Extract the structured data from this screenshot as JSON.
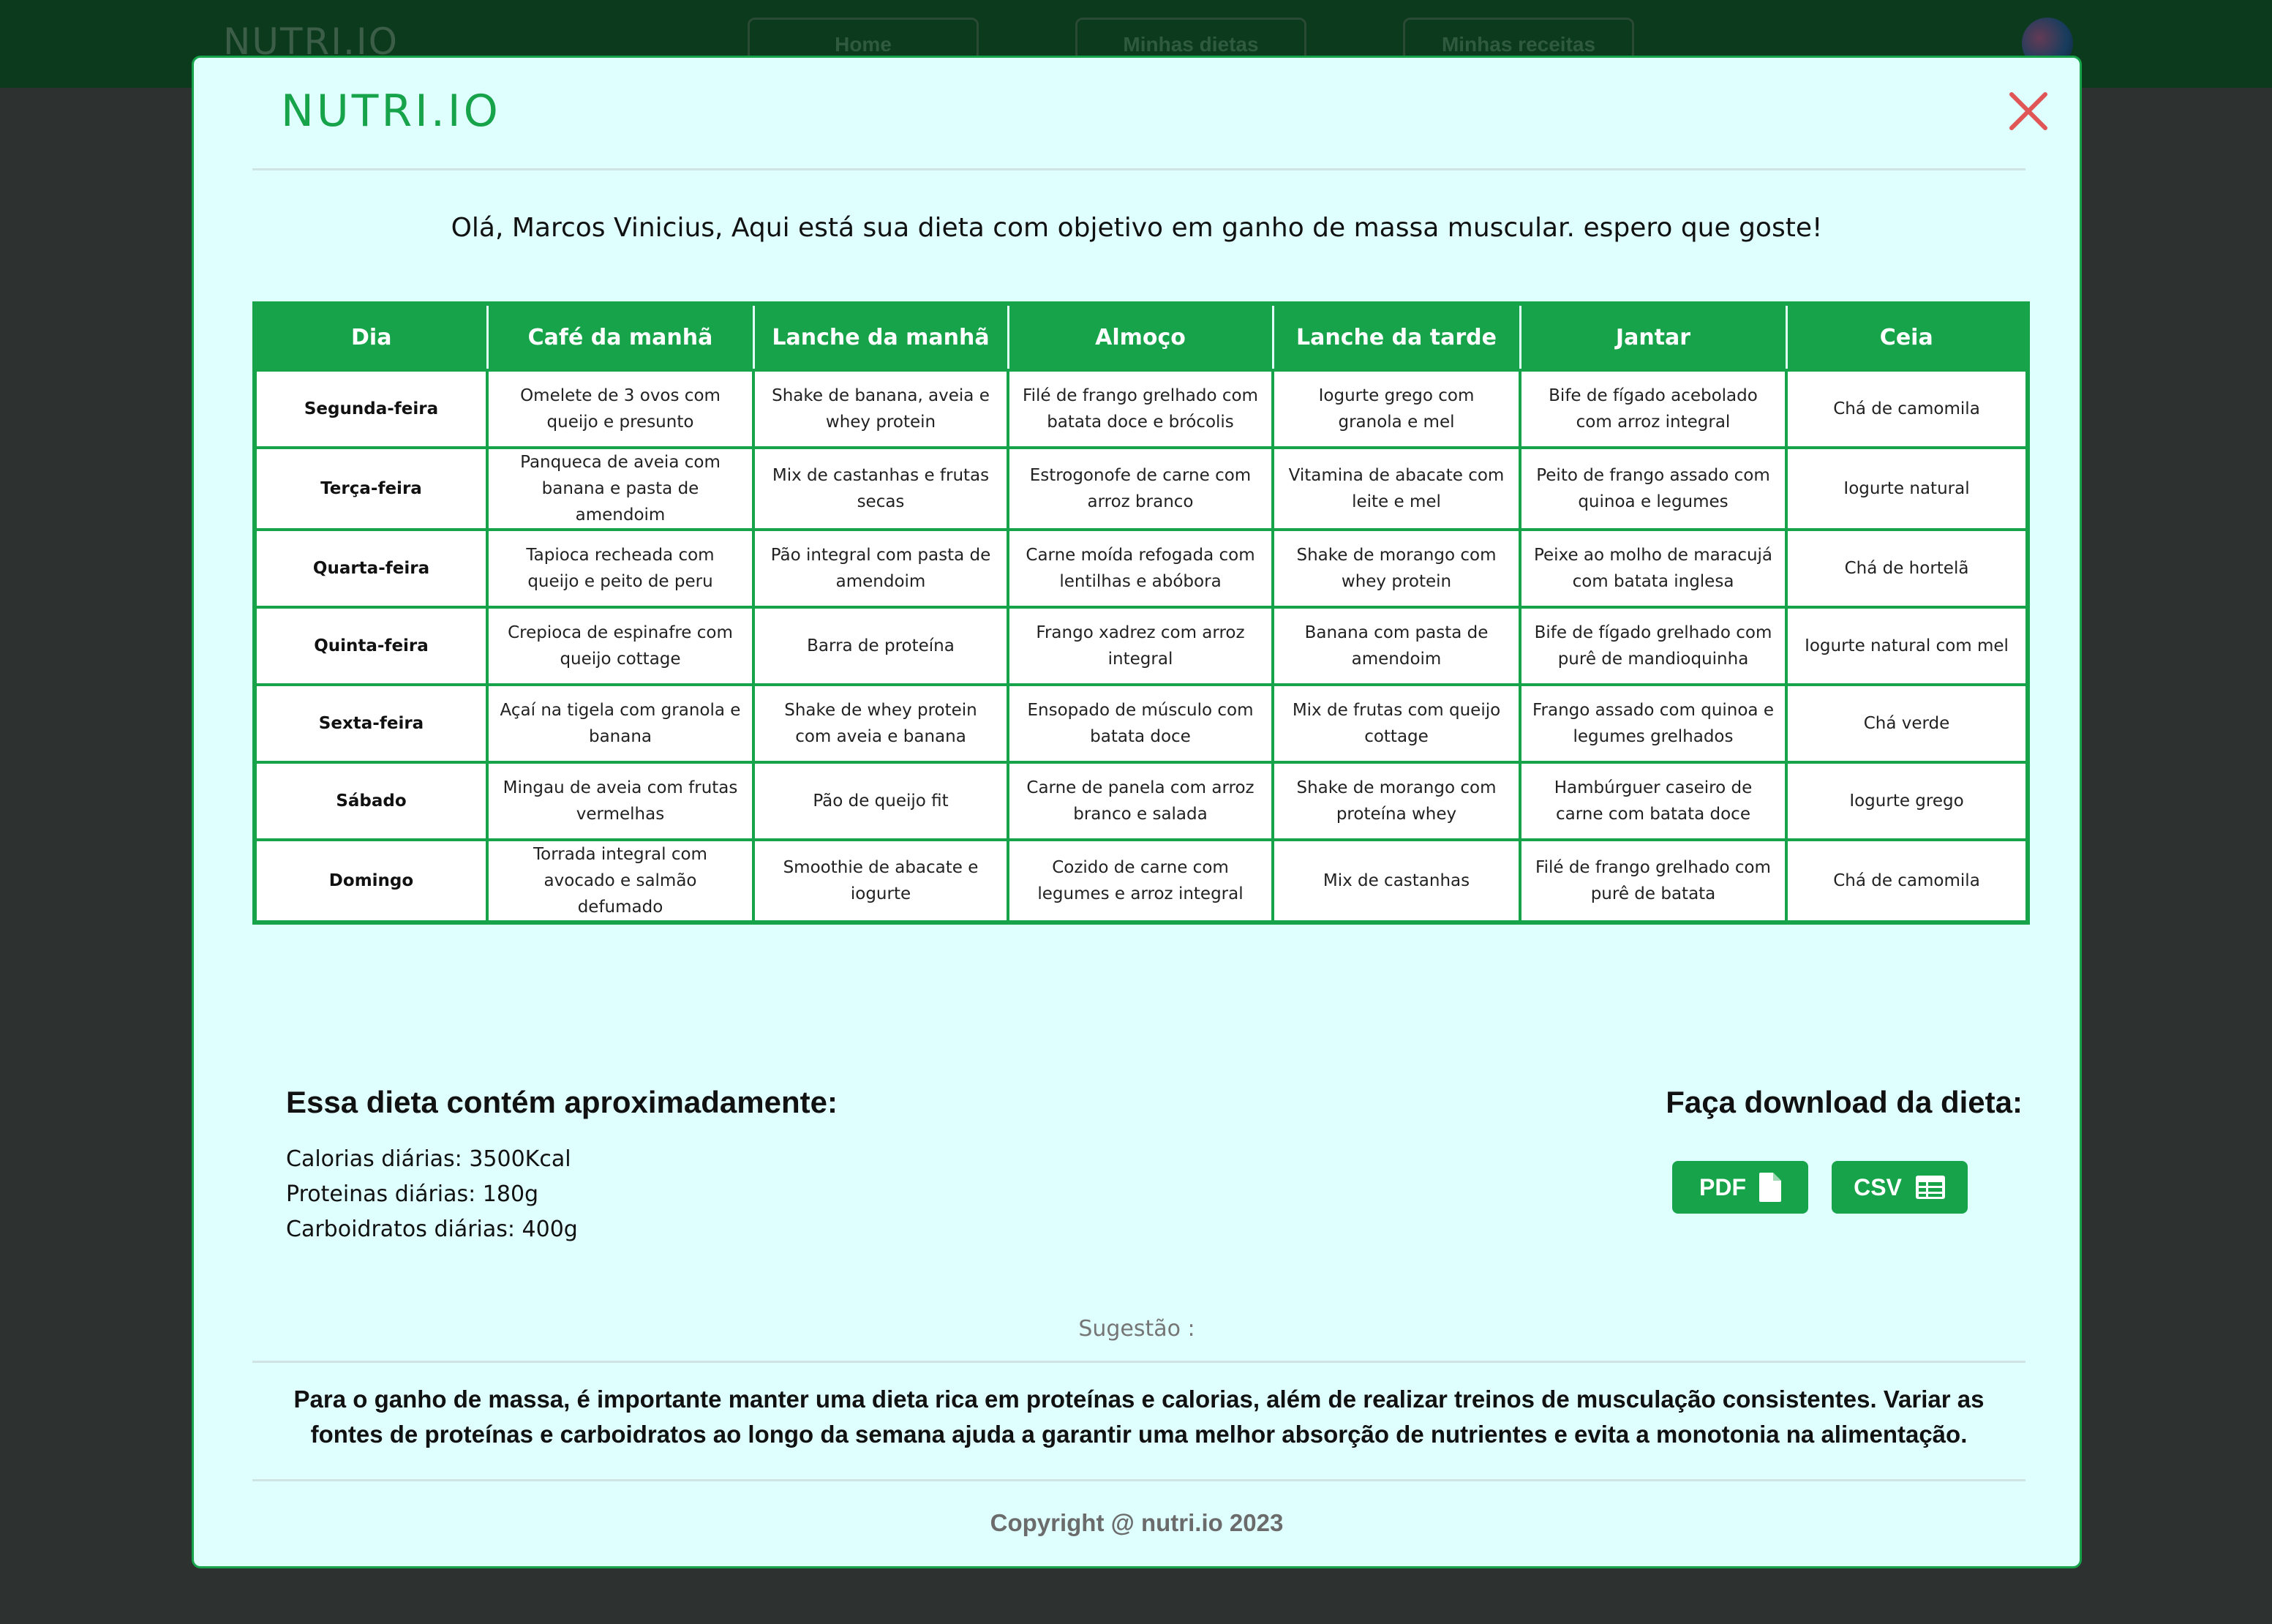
{
  "background": {
    "brand": "NUTRI.IO",
    "nav": [
      "Home",
      "Minhas dietas",
      "Minhas receitas"
    ]
  },
  "modal": {
    "logo": "NUTRI.IO",
    "greeting": "Olá, Marcos Vinicius, Aqui está sua dieta com objetivo em ganho de massa muscular. espero que goste!",
    "table": {
      "headers": [
        "Dia",
        "Café da manhã",
        "Lanche da manhã",
        "Almoço",
        "Lanche da tarde",
        "Jantar",
        "Ceia"
      ],
      "rows": [
        [
          "Segunda-feira",
          "Omelete de 3 ovos com queijo e presunto",
          "Shake de banana, aveia e whey protein",
          "Filé de frango grelhado com batata doce e brócolis",
          "Iogurte grego com granola e mel",
          "Bife de fígado acebolado com arroz integral",
          "Chá de camomila"
        ],
        [
          "Terça-feira",
          "Panqueca de aveia com banana e pasta de amendoim",
          "Mix de castanhas e frutas secas",
          "Estrogonofe de carne com arroz branco",
          "Vitamina de abacate com leite e mel",
          "Peito de frango assado com quinoa e legumes",
          "Iogurte natural"
        ],
        [
          "Quarta-feira",
          "Tapioca recheada com queijo e peito de peru",
          "Pão integral com pasta de amendoim",
          "Carne moída refogada com lentilhas e abóbora",
          "Shake de morango com whey protein",
          "Peixe ao molho de maracujá com batata inglesa",
          "Chá de hortelã"
        ],
        [
          "Quinta-feira",
          "Crepioca de espinafre com queijo cottage",
          "Barra de proteína",
          "Frango xadrez com arroz integral",
          "Banana com pasta de amendoim",
          "Bife de fígado grelhado com purê de mandioquinha",
          "Iogurte natural com mel"
        ],
        [
          "Sexta-feira",
          "Açaí na tigela com granola e banana",
          "Shake de whey protein com aveia e banana",
          "Ensopado de músculo com batata doce",
          "Mix de frutas com queijo cottage",
          "Frango assado com quinoa e legumes grelhados",
          "Chá verde"
        ],
        [
          "Sábado",
          "Mingau de aveia com frutas vermelhas",
          "Pão de queijo fit",
          "Carne de panela com arroz branco e salada",
          "Shake de morango com proteína whey",
          "Hambúrguer caseiro de carne com batata doce",
          "Iogurte grego"
        ],
        [
          "Domingo",
          "Torrada integral com avocado e salmão defumado",
          "Smoothie de abacate e iogurte",
          "Cozido de carne com legumes e arroz integral",
          "Mix de castanhas",
          "Filé de frango grelhado com purê de batata",
          "Chá de camomila"
        ]
      ]
    },
    "macros": {
      "title": "Essa dieta contém aproximadamente:",
      "calories": "Calorias diárias: 3500Kcal",
      "proteins": "Proteinas diárias: 180g",
      "carbs": "Carboidratos diárias: 400g"
    },
    "download": {
      "title": "Faça download da dieta:",
      "pdf_label": "PDF",
      "csv_label": "CSV"
    },
    "suggestion": {
      "label": "Sugestão :",
      "text": "Para o ganho de massa, é importante manter uma dieta rica em proteínas e calorias, além de realizar treinos de musculação consistentes. Variar as fontes de proteínas e carboidratos ao longo da semana ajuda a garantir uma melhor absorção de nutrientes e evita a monotonia na alimentação."
    },
    "copyright": "Copyright @ nutri.io 2023"
  },
  "colors": {
    "accent": "#16a34a",
    "modal_bg": "#defffe",
    "close": "#e05555",
    "topbar": "#0b3a1d",
    "overlay": "#2d3230"
  },
  "icons": {
    "close": "close-icon",
    "pdf": "file-icon",
    "csv": "table-icon"
  }
}
